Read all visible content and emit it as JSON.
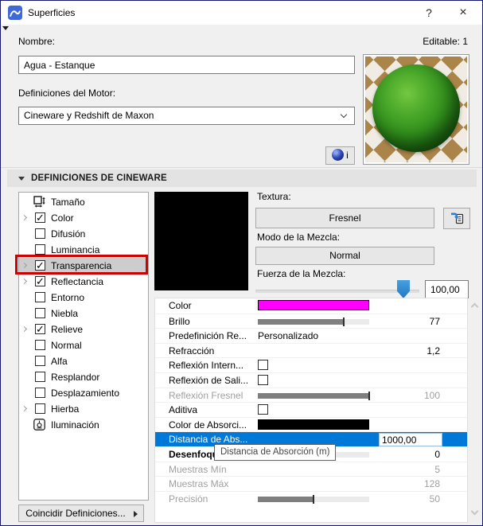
{
  "window": {
    "title": "Superficies",
    "help_glyph": "?",
    "close_glyph": "×"
  },
  "header": {
    "name_label": "Nombre:",
    "editable_status": "Editable: 1",
    "name_value": "Agua - Estanque",
    "engine_label": "Definiciones del Motor:",
    "engine_value": "Cineware y Redshift de Maxon"
  },
  "preview": {
    "c4d_info_label": "i"
  },
  "section": {
    "title": "DEFINICIONES DE CINEWARE"
  },
  "tree": {
    "items": [
      {
        "label": "Tamaño",
        "icon": "size"
      },
      {
        "label": "Color",
        "check": true,
        "checked": true,
        "expander": true
      },
      {
        "label": "Difusión",
        "check": true,
        "checked": false
      },
      {
        "label": "Luminancia",
        "check": true,
        "checked": false
      },
      {
        "label": "Transparencia",
        "check": true,
        "checked": true,
        "expander": true,
        "selected": true
      },
      {
        "label": "Reflectancia",
        "check": true,
        "checked": true,
        "expander": true
      },
      {
        "label": "Entorno",
        "check": true,
        "checked": false
      },
      {
        "label": "Niebla",
        "check": true,
        "checked": false
      },
      {
        "label": "Relieve",
        "check": true,
        "checked": true,
        "expander": true
      },
      {
        "label": "Normal",
        "check": true,
        "checked": false
      },
      {
        "label": "Alfa",
        "check": true,
        "checked": false
      },
      {
        "label": "Resplandor",
        "check": true,
        "checked": false
      },
      {
        "label": "Desplazamiento",
        "check": true,
        "checked": false
      },
      {
        "label": "Hierba",
        "check": true,
        "checked": false,
        "expander": true
      },
      {
        "label": "Iluminación",
        "icon": "lamp"
      }
    ]
  },
  "texture": {
    "texture_label": "Textura:",
    "texture_value": "Fresnel",
    "blend_mode_label": "Modo de la Mezcla:",
    "blend_mode_value": "Normal",
    "strength_label": "Fuerza de la Mezcla:",
    "strength_value": "100,00"
  },
  "properties": {
    "rows": [
      {
        "label": "Color",
        "type": "swatch",
        "swatch": "#ff00ff"
      },
      {
        "label": "Brillo",
        "type": "slider",
        "pct": 77,
        "value": "77"
      },
      {
        "label": "Predefinición Re...",
        "type": "text",
        "text": "Personalizado"
      },
      {
        "label": "Refracción",
        "type": "none",
        "value": "1,2"
      },
      {
        "label": "Reflexión Intern...",
        "type": "check"
      },
      {
        "label": "Reflexión de Sali...",
        "type": "check"
      },
      {
        "label": "Reflexión Fresnel",
        "type": "slider",
        "pct": 100,
        "value": "100",
        "disabled": true
      },
      {
        "label": "Aditiva",
        "type": "check"
      },
      {
        "label": "Color de Absorci...",
        "type": "swatch",
        "swatch": "#000000"
      },
      {
        "label": "Distancia de Abs...",
        "type": "input",
        "value": "1000,00",
        "selected": true
      },
      {
        "label": "Desenfoque",
        "type": "slider",
        "pct": 0,
        "value": "0",
        "emphasis": true
      },
      {
        "label": "Muestras Mín",
        "type": "none",
        "value": "5",
        "disabled": true
      },
      {
        "label": "Muestras Máx",
        "type": "none",
        "value": "128",
        "disabled": true
      },
      {
        "label": "Precisión",
        "type": "slider",
        "pct": 50,
        "value": "50",
        "disabled": true
      }
    ]
  },
  "tooltip": {
    "text": "Distancia de Absorción (m)"
  },
  "footer": {
    "match_label": "Coincidir Definiciones..."
  },
  "colors": {
    "accent": "#0078d7",
    "annotation": "#cf0000",
    "selection_gray": "#cdcdcd"
  }
}
